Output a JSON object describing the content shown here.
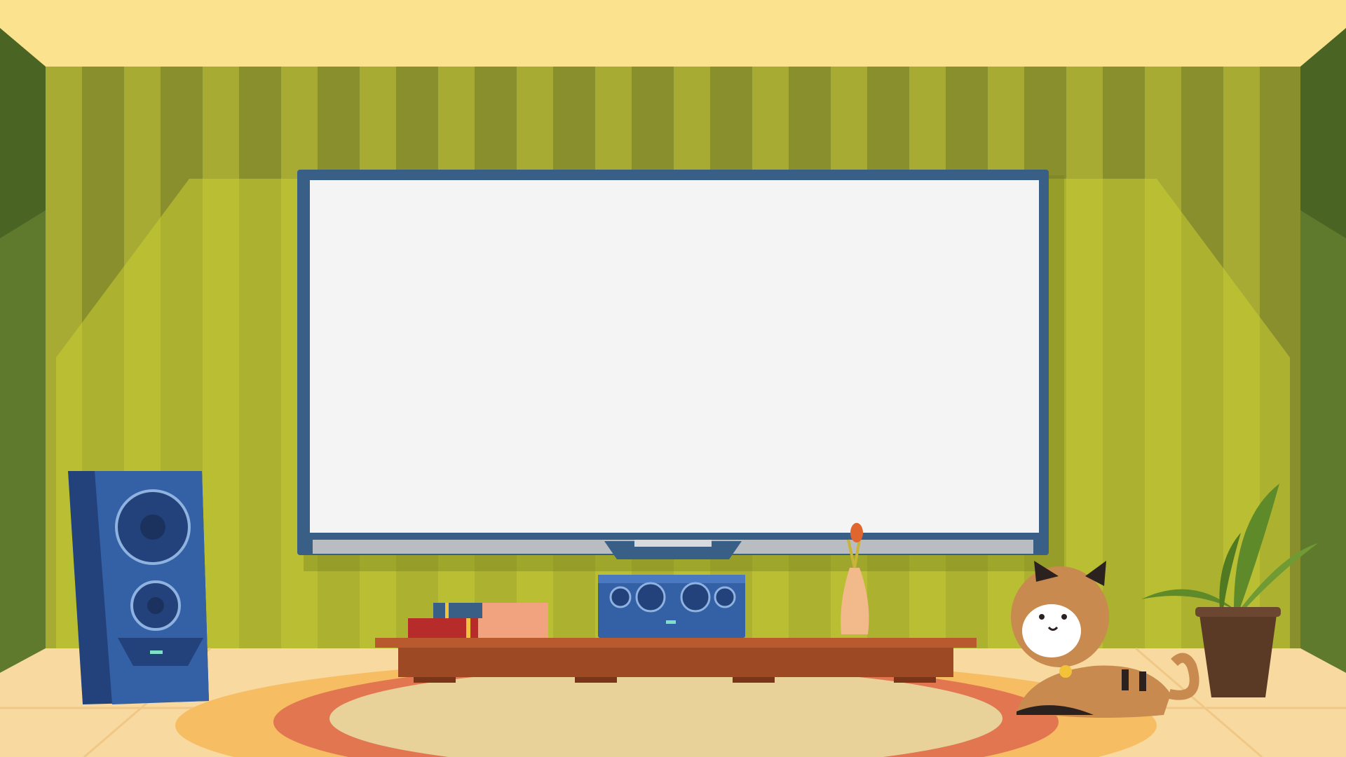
{
  "scene": {
    "description_tag": "cartoon-living-room",
    "colors": {
      "ceiling": "#fae28e",
      "wall_dark_stripe": "#8a8f2e",
      "wall_light_stripe": "#a7ab34",
      "wall_glow": "#c9cd33",
      "side_wall": "#5f7a2c",
      "side_wall_dark": "#4a6424",
      "floor": "#f8d9a0",
      "rug_outer": "#f7bd63",
      "rug_ring": "#e27650",
      "rug_inner": "#e8d29a",
      "tv_frame": "#3a5f86",
      "tv_screen": "#f4f4f4",
      "tv_stand": "#b9bcc0",
      "cabinet_top": "#b85a2e",
      "cabinet_body": "#9d4a24",
      "speaker_body": "#3460a6",
      "speaker_dark": "#23417a",
      "plant_leaf": "#5f8a2a",
      "pot": "#5a3a25",
      "cat_body": "#c88a4e",
      "cat_face": "#ffffff"
    },
    "objects": [
      "tv-screen",
      "speaker",
      "soundbar",
      "books",
      "vase",
      "cat",
      "plant",
      "tv-cabinet",
      "round-rug"
    ]
  }
}
